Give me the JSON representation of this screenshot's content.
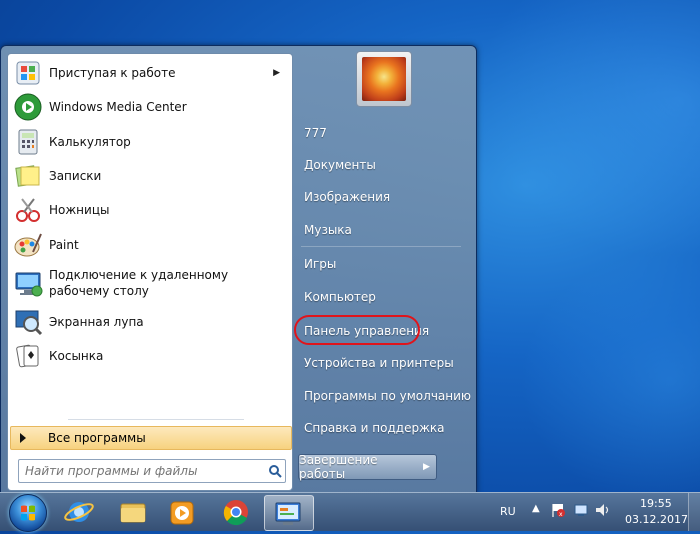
{
  "start_menu": {
    "programs": [
      {
        "label": "Приступая к работе",
        "icon": "getting-started-icon",
        "has_arrow": true
      },
      {
        "label": "Windows Media Center",
        "icon": "media-center-icon"
      },
      {
        "label": "Калькулятор",
        "icon": "calculator-icon"
      },
      {
        "label": "Записки",
        "icon": "sticky-notes-icon"
      },
      {
        "label": "Ножницы",
        "icon": "snipping-tool-icon"
      },
      {
        "label": "Paint",
        "icon": "paint-icon"
      },
      {
        "label": "Подключение к удаленному рабочему столу",
        "icon": "remote-desktop-icon"
      },
      {
        "label": "Экранная лупа",
        "icon": "magnifier-icon"
      },
      {
        "label": "Косынка",
        "icon": "solitaire-icon"
      }
    ],
    "all_programs_label": "Все программы",
    "search_placeholder": "Найти программы и файлы",
    "right_links": [
      {
        "label": "777"
      },
      {
        "label": "Документы"
      },
      {
        "label": "Изображения"
      },
      {
        "label": "Музыка"
      },
      {
        "label": "Игры"
      },
      {
        "label": "Компьютер"
      },
      {
        "label": "Панель управления",
        "highlighted": true
      },
      {
        "label": "Устройства и принтеры"
      },
      {
        "label": "Программы по умолчанию"
      },
      {
        "label": "Справка и поддержка"
      }
    ],
    "shutdown_label": "Завершение работы"
  },
  "taskbar": {
    "pinned": [
      "internet-explorer-icon",
      "explorer-folder-icon",
      "media-player-icon",
      "chrome-icon",
      "control-panel-icon"
    ],
    "language": "RU",
    "time": "19:55",
    "date": "03.12.2017"
  },
  "colors": {
    "highlight_ring": "#e0141b",
    "all_programs_bg": "#f7d27f",
    "desktop": "#1565c5"
  }
}
